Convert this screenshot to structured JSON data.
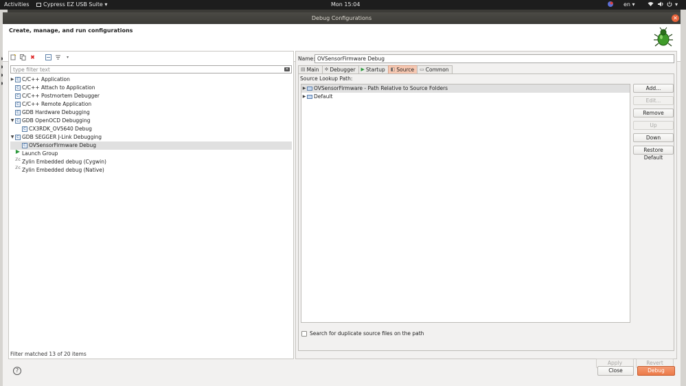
{
  "topbar": {
    "activities": "Activities",
    "app_name": "Cypress EZ USB Suite",
    "clock": "Mon 15:04",
    "lang": "en"
  },
  "dialog": {
    "title": "Debug Configurations",
    "subtitle": "Create, manage, and run configurations"
  },
  "left": {
    "filter_placeholder": "type filter text",
    "tree": [
      {
        "label": "C/C++ Application",
        "level": 0,
        "twist": "▶",
        "icon": "c"
      },
      {
        "label": "C/C++ Attach to Application",
        "level": 0,
        "twist": "",
        "icon": "c"
      },
      {
        "label": "C/C++ Postmortem Debugger",
        "level": 0,
        "twist": "",
        "icon": "c"
      },
      {
        "label": "C/C++ Remote Application",
        "level": 0,
        "twist": "",
        "icon": "c"
      },
      {
        "label": "GDB Hardware Debugging",
        "level": 0,
        "twist": "",
        "icon": "c"
      },
      {
        "label": "GDB OpenOCD Debugging",
        "level": 0,
        "twist": "▼",
        "icon": "c"
      },
      {
        "label": "CX3RDK_OV5640 Debug",
        "level": 1,
        "twist": "",
        "icon": "c"
      },
      {
        "label": "GDB SEGGER J-Link Debugging",
        "level": 0,
        "twist": "▼",
        "icon": "c"
      },
      {
        "label": "OVSensorFirmware Debug",
        "level": 1,
        "twist": "",
        "icon": "c",
        "selected": true
      },
      {
        "label": "Launch Group",
        "level": 0,
        "twist": "",
        "icon": "green"
      },
      {
        "label": "Zylin Embedded debug (Cygwin)",
        "level": 0,
        "twist": "",
        "icon": "zy"
      },
      {
        "label": "Zylin Embedded debug (Native)",
        "level": 0,
        "twist": "",
        "icon": "zy"
      }
    ],
    "filter_status": "Filter matched 13 of 20 items"
  },
  "right": {
    "name_label": "Name:",
    "name_value": "OVSensorFirmware Debug",
    "tabs": [
      {
        "label": "Main",
        "icon": "▤",
        "active": false
      },
      {
        "label": "Debugger",
        "icon": "✲",
        "active": false
      },
      {
        "label": "Startup",
        "icon": "▶",
        "active": false
      },
      {
        "label": "Source",
        "icon": "◧",
        "active": true
      },
      {
        "label": "Common",
        "icon": "▭",
        "active": false
      }
    ],
    "source_lookup_label": "Source Lookup Path:",
    "source_items": [
      {
        "label": "OVSensorFirmware - Path Relative to Source Folders",
        "selected": true
      },
      {
        "label": "Default",
        "selected": false
      }
    ],
    "buttons": {
      "add": "Add...",
      "edit": "Edit...",
      "remove": "Remove",
      "up": "Up",
      "down": "Down",
      "restore": "Restore Default"
    },
    "duplicate_label": "Search for duplicate source files on the path",
    "apply": "Apply",
    "revert": "Revert"
  },
  "bottom": {
    "help": "?",
    "close": "Close",
    "debug": "Debug"
  },
  "colors": {
    "accent": "#ec7a48",
    "active_tab": "#f7c8b2",
    "titlebar": "#3c3b37"
  }
}
